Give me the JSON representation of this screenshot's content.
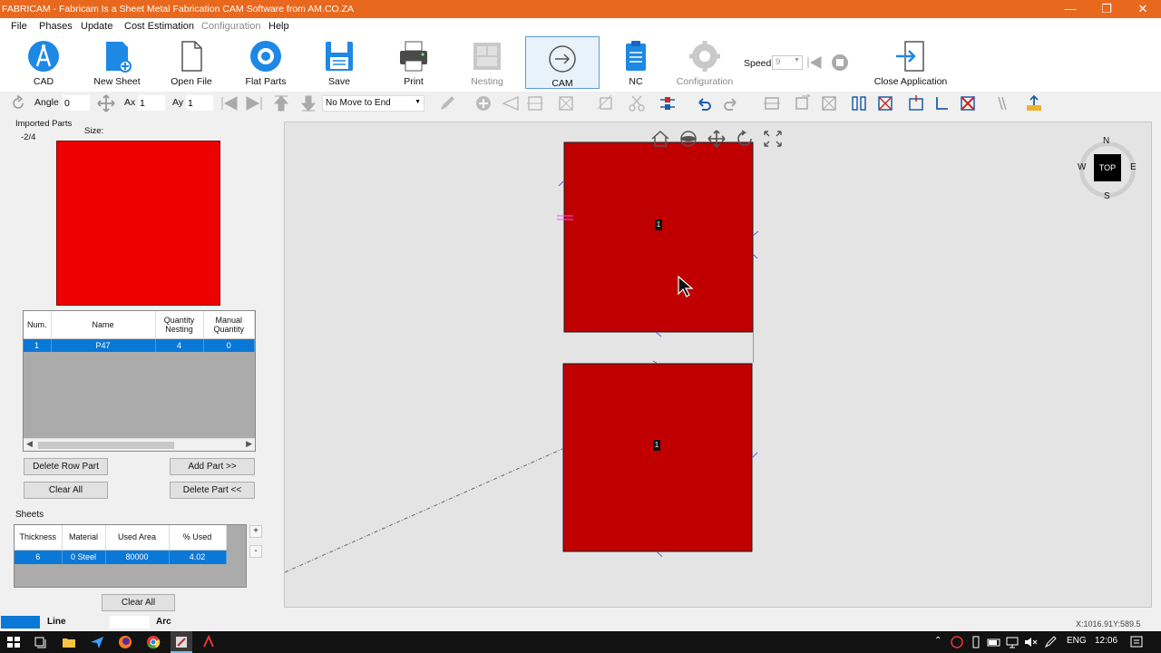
{
  "window": {
    "title": "FABRICAM - Fabricam Is a Sheet Metal Fabrication CAM Software from AM.CO.ZA"
  },
  "menu": [
    "File",
    "Phases",
    "Update",
    "Cost Estimation",
    "Configuration",
    "Help"
  ],
  "ribbon": {
    "cad": "CAD",
    "new_sheet": "New Sheet",
    "open_file": "Open File",
    "flat_parts": "Flat Parts",
    "save": "Save",
    "print": "Print",
    "nesting": "Nesting",
    "cam": "CAM",
    "nc": "NC",
    "configuration": "Configuration",
    "speed_label": "Speed",
    "speed_value": "9",
    "close_application": "Close Application"
  },
  "toolbar": {
    "angle_label": "Angle",
    "angle_value": "0",
    "ax_label": "Ax",
    "ax_value": "1",
    "ay_label": "Ay",
    "ay_value": "1",
    "move_select": "No Move to End"
  },
  "left": {
    "imported_parts_title": "Imported Parts",
    "part_counter": "-2/4",
    "size_label": "Size:",
    "parts_columns": [
      "Num.",
      "Name",
      "Quantity Nesting",
      "Manual Quantity"
    ],
    "parts_rows": [
      [
        "1",
        "P47",
        "4",
        "0"
      ]
    ],
    "delete_row_part": "Delete Row Part",
    "add_part": "Add Part >>",
    "clear_all": "Clear All",
    "delete_part": "Delete Part <<",
    "sheets_title": "Sheets",
    "sheets_columns": [
      "Thickness",
      "Material",
      "Used Area",
      "% Used"
    ],
    "sheets_rows": [
      [
        "6",
        "0  Steel",
        "80000",
        "4.02"
      ]
    ],
    "plus": "+",
    "minus": "-",
    "sheets_clear_all": "Clear All"
  },
  "canvas": {
    "part_label_1": "1",
    "part_label_2": "1",
    "compass": {
      "n": "N",
      "s": "S",
      "e": "E",
      "w": "W",
      "top": "TOP"
    }
  },
  "status": {
    "line": "Line",
    "arc": "Arc",
    "coords": "X:1016.91Y:589.5"
  },
  "taskbar": {
    "lang": "ENG",
    "time": "12:06"
  },
  "colors": {
    "titlebar": "#e8681e",
    "selection": "#0a78d7",
    "part_fill": "#c00000",
    "preview_fill": "#ee0000"
  }
}
